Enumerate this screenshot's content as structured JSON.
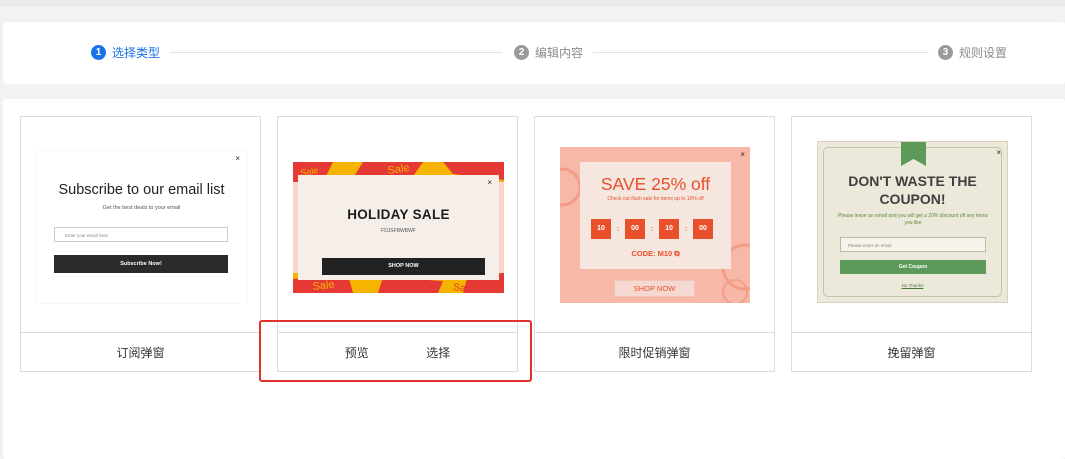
{
  "steps": [
    {
      "num": "1",
      "label": "选择类型",
      "active": true
    },
    {
      "num": "2",
      "label": "编辑内容",
      "active": false
    },
    {
      "num": "3",
      "label": "规则设置",
      "active": false
    }
  ],
  "colors": {
    "accent": "#1a73e8",
    "highlight": "#e2312a",
    "sale_orange": "#e8502b",
    "coupon_green": "#5d9a5a"
  },
  "cards": [
    {
      "footer": "订阅弹窗",
      "preview": {
        "close": "×",
        "title": "Subscribe to our email list",
        "subtitle": "Get the best deals to your email",
        "placeholder": "Enter your email here",
        "button": "Subscribe Now!"
      }
    },
    {
      "footer_actions": [
        "预览",
        "选择"
      ],
      "preview": {
        "close": "×",
        "title": "HOLIDAY SALE",
        "code": "FDJSFBWBWF",
        "button": "SHOP NOW",
        "banner_word": "Sale"
      }
    },
    {
      "footer": "限时促销弹窗",
      "preview": {
        "close": "×",
        "title": "SAVE 25% off",
        "subtitle": "Check out flash sale for items up to 10% off",
        "timer": [
          "10",
          "00",
          "10",
          "00"
        ],
        "code_line": "CODE: M10 ⧉",
        "button": "SHOP NOW"
      }
    },
    {
      "footer": "挽留弹窗",
      "preview": {
        "close": "×",
        "title_line1": "DON'T WASTE THE",
        "title_line2": "COUPON!",
        "subtitle": "Please leave an email and you will get a 20% discount off any items you like",
        "placeholder": "Please enter an email",
        "button": "Get Coupon",
        "link": "No Thanks"
      }
    }
  ]
}
